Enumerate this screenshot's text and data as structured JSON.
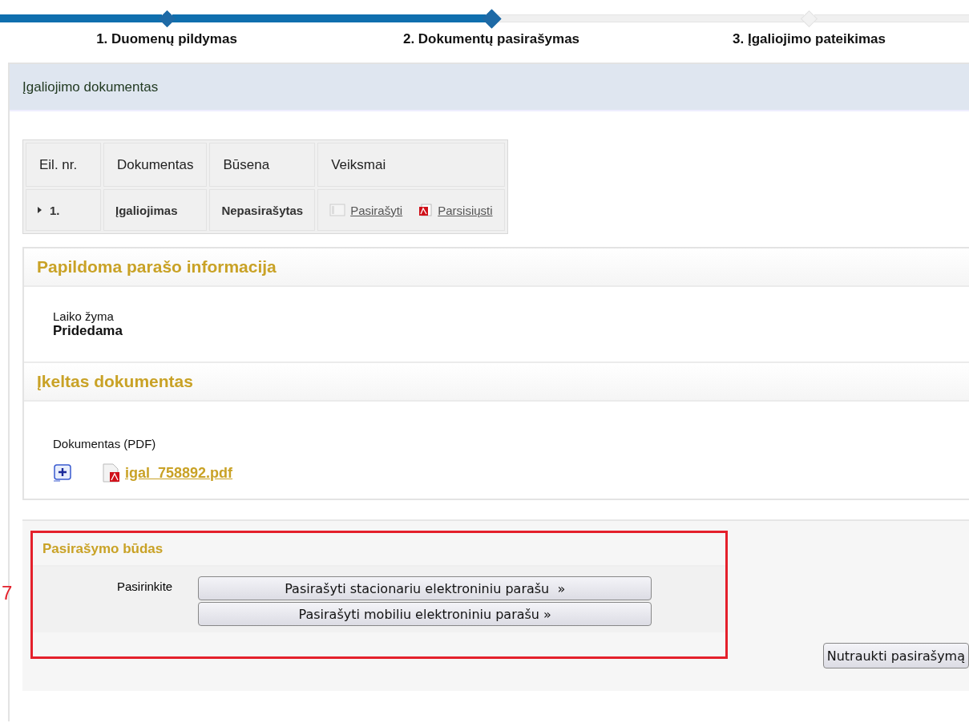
{
  "steps": [
    {
      "label": "1. Duomenų pildymas",
      "completed": true,
      "selected": false
    },
    {
      "label": "2. Dokumentų pasirašymas",
      "completed": false,
      "selected": true
    },
    {
      "label": "3. Įgaliojimo pateikimas",
      "completed": false,
      "selected": false
    }
  ],
  "panel": {
    "title": "Įgaliojimo dokumentas"
  },
  "table": {
    "columns": [
      "Eil. nr.",
      "Dokumentas",
      "Būsena",
      "Veiksmai"
    ],
    "rows": [
      {
        "number": "1.",
        "expanded": false,
        "document": "Įgaliojimas",
        "status": "Nepasirašytas",
        "actions": [
          {
            "kind": "sign",
            "label": "Pasirašyti"
          },
          {
            "kind": "download",
            "label": "Parsisiųsti"
          }
        ]
      }
    ]
  },
  "signature_info": {
    "title": "Papildoma parašo informacija",
    "label": "Laiko žyma",
    "value": "Pridedama"
  },
  "uploaded": {
    "title": "Įkeltas dokumentas",
    "label": "Dokumentas (PDF)",
    "file": "igal_758892.pdf"
  },
  "signing": {
    "title": "Pasirašymo būdas",
    "prompt": "Pasirinkite",
    "buttons": [
      "Pasirašyti stacionariu elektroniniu parašu  »",
      "Pasirašyti mobiliu elektroniniu parašu »"
    ]
  },
  "annotation": {
    "label": "7"
  },
  "cancel_button": "Nutraukti pasirašymą"
}
